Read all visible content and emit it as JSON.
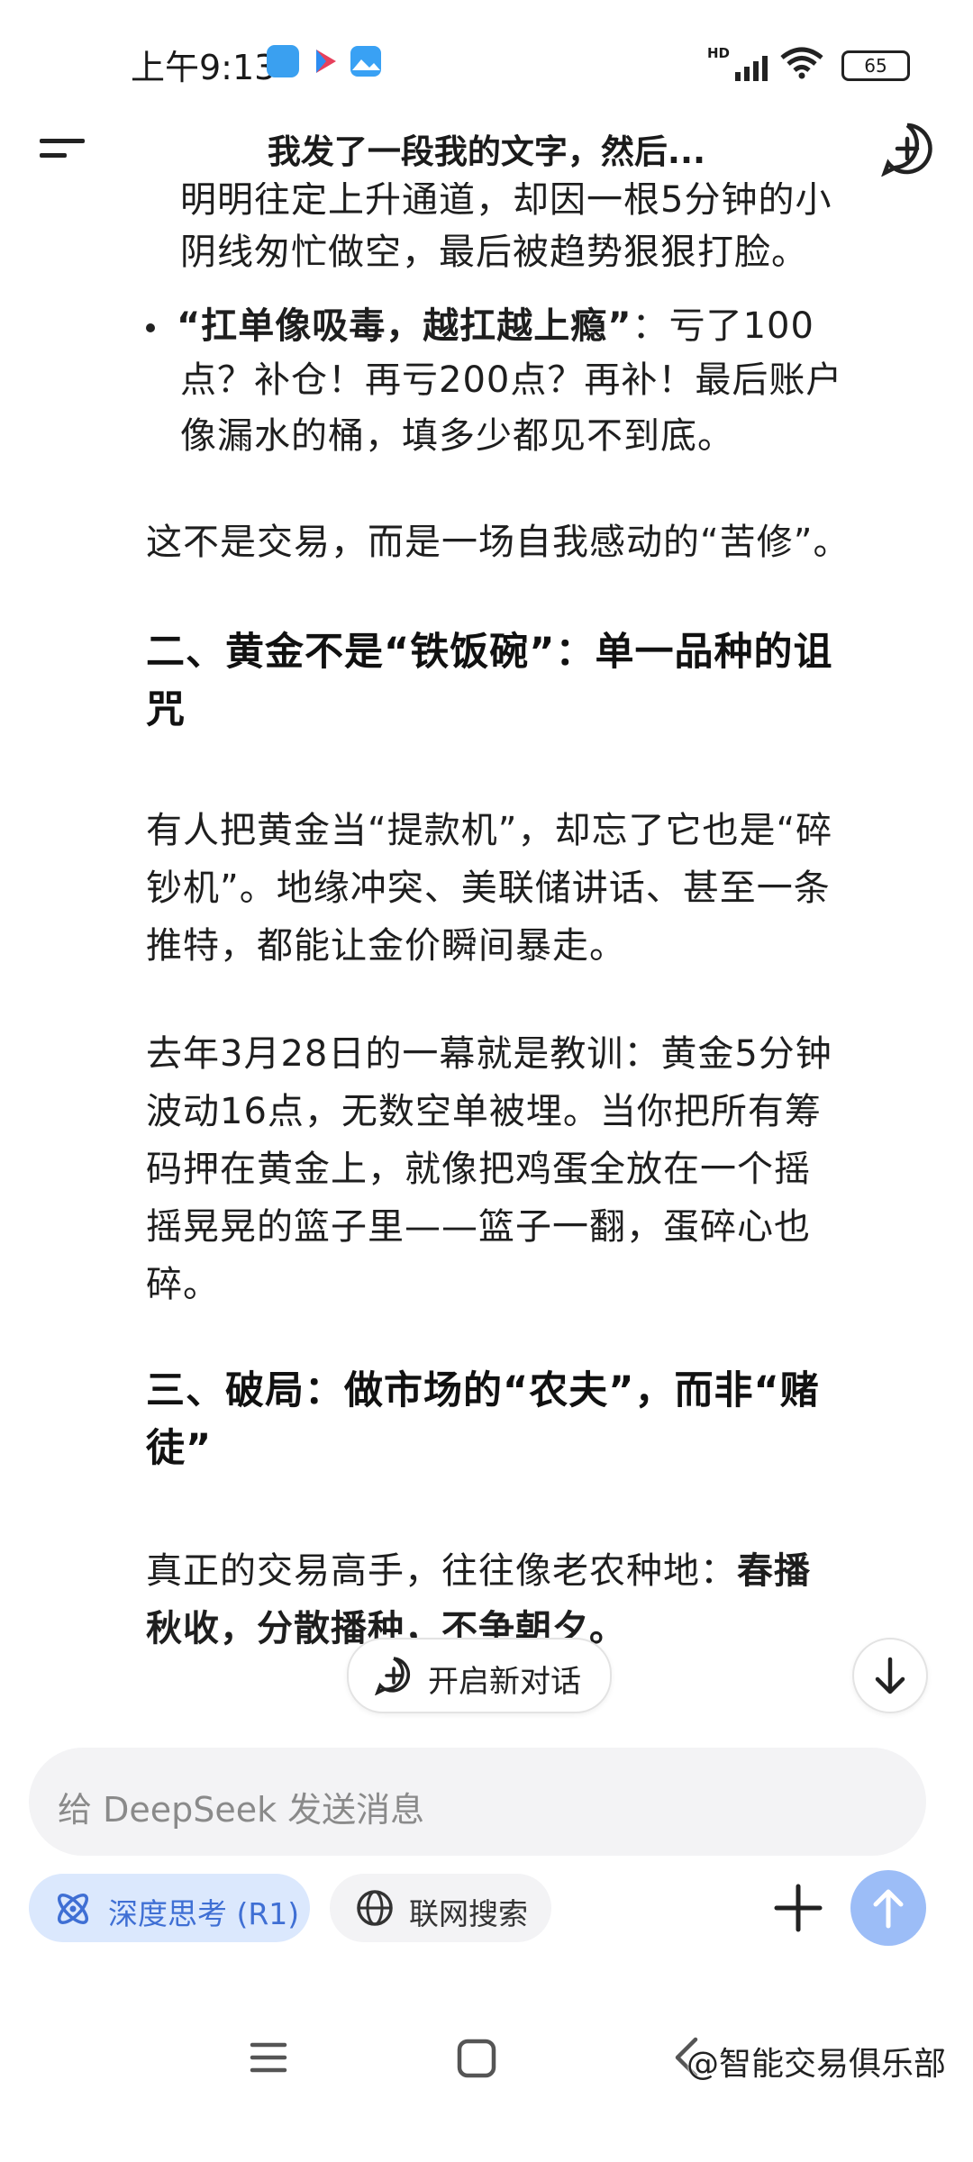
{
  "status_bar": {
    "time": "上午9:13",
    "battery": "65",
    "network": "HD"
  },
  "header": {
    "title": "我发了一段我的文字，然后..."
  },
  "content": {
    "partial_line": "明明往定上升通道，却因一根5分钟的小",
    "p1_line2": "阴线匆忙做空，最后被趋势狠狠打脸。",
    "bullet2_bold": "“扛单像吸毒，越扛越上瘾”",
    "bullet2_rest": "：亏了100",
    "bullet2_line2": "点？补仓！再亏200点？再补！最后账户",
    "bullet2_line3": "像漏水的桶，填多少都见不到底。",
    "para1": "这不是交易，而是一场自我感动的“苦修”。",
    "h2_line1": "二、黄金不是“铁饭碗”：单一品种的诅",
    "h2_line2": "咒",
    "p2_line1": "有人把黄金当“提款机”，却忘了它也是“碎",
    "p2_line2": "钞机”。地缘冲突、美联储讲话、甚至一条",
    "p2_line3": "推特，都能让金价瞬间暴走。",
    "p3_line1": "去年3月28日的一幕就是教训：黄金5分钟",
    "p3_line2": "波动16点，无数空单被埋。当你把所有筹",
    "p3_line3": "码押在黄金上，就像把鸡蛋全放在一个摇",
    "p3_line4": "摇晃晃的篮子里——篮子一翻，蛋碎心也",
    "p3_line5": "碎。",
    "h3_line1": "三、破局：做市场的“农夫”，而非“赌",
    "h3_line2": "徒”",
    "p4_line1_normal": "真正的交易高手，往往像老农种地：",
    "p4_line1_bold": "春播",
    "p4_line2": "秋收，分散播种，不争朝夕。"
  },
  "floating": {
    "new_conversation": "开启新对话"
  },
  "composer": {
    "placeholder": "给 DeepSeek 发送消息",
    "deep_think": "深度思考 (R1)",
    "web_search": "联网搜索"
  },
  "watermark": "@智能交易俱乐部",
  "colors": {
    "accent": "#4d6bfe",
    "send_disabled": "#9cbdf7",
    "chip_active_bg": "#dbe8fd"
  }
}
